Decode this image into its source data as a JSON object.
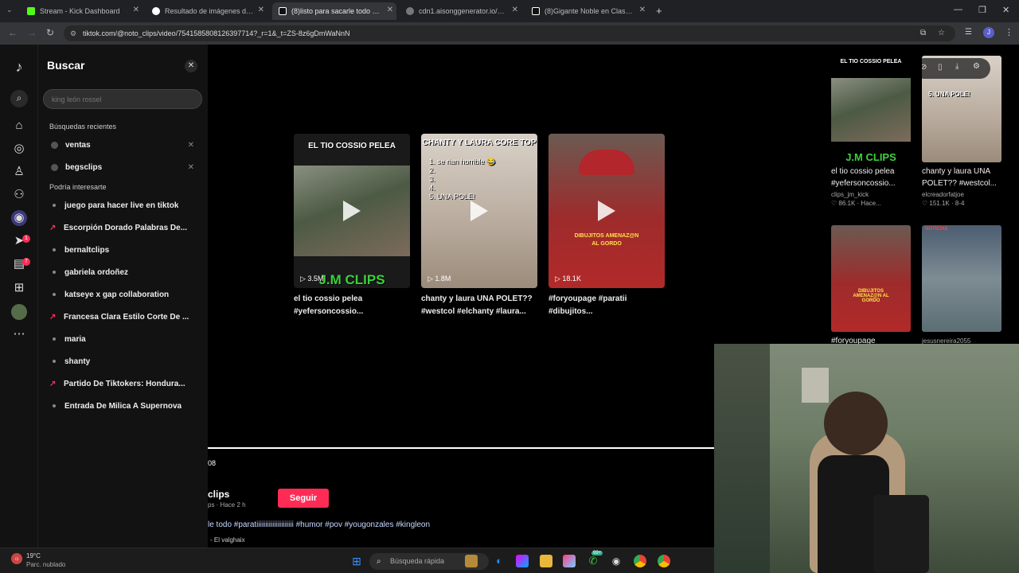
{
  "browser": {
    "tabs": [
      {
        "label": "Stream - Kick Dashboard"
      },
      {
        "label": "Resultado de imágenes de Goo"
      },
      {
        "label": "(8)listo para sacarle todo #parat"
      },
      {
        "label": "cdn1.aisonggenerator.io/7/aud"
      },
      {
        "label": "(8)Gigante Noble en Clash Roya"
      }
    ],
    "new_tab": "+",
    "url": "tiktok.com/@noto_clips/video/7541585808126397714?_r=1&_t=ZS-8z6gDmWaNnN",
    "avatar_letter": "J"
  },
  "search": {
    "title": "Buscar",
    "placeholder": "king león rossel",
    "recent_heading": "Búsquedas recientes",
    "recent": [
      {
        "label": "ventas"
      },
      {
        "label": "begsclips"
      }
    ],
    "suggest_heading": "Podría interesarte",
    "suggestions": [
      {
        "label": "juego para hacer live en tiktok",
        "trending": false
      },
      {
        "label": "Escorpión Dorado Palabras De...",
        "trending": true
      },
      {
        "label": "bernaltclips",
        "trending": false
      },
      {
        "label": "gabriela ordoñez",
        "trending": false
      },
      {
        "label": "katseye x gap collaboration",
        "trending": false
      },
      {
        "label": "Francesa Clara Estilo Corte De ...",
        "trending": true
      },
      {
        "label": "maria",
        "trending": false
      },
      {
        "label": "shanty",
        "trending": false
      },
      {
        "label": "Partido De Tiktokers: Hondura...",
        "trending": true
      },
      {
        "label": "Entrada De Milica A Supernova",
        "trending": false
      }
    ]
  },
  "rail_badges": {
    "inbox": "1",
    "messages": "7"
  },
  "grid": [
    {
      "overlay": "EL TIO COSSIO PELEA",
      "brand": "J.M CLIPS",
      "views": "3.5M",
      "title": "el tio cossio pelea #yefersoncossio..."
    },
    {
      "overlay": "CHANTY Y LAURA CORE TOP",
      "list": "1. se rian horrible 😂\n2.\n3.\n4.\n5. UNA POLE!",
      "views": "1.8M",
      "title": "chanty y laura UNA POLET?? #westcol #elchanty #laura..."
    },
    {
      "overlay": "DIBUJITOS AMENAZ@N AL GORDO",
      "views": "18.1K",
      "title": "#foryoupage #paratii #dibujitos..."
    }
  ],
  "right_grid": [
    {
      "overlay": "EL TIO COSSIO PELEA",
      "brand": "J.M CLIPS",
      "title": "el tio cossio pelea #yefersoncossio...",
      "author": "clips_jm_kick",
      "likes": "86.1K",
      "time": "Hace..."
    },
    {
      "overlay": "5. UNA POLE!",
      "title": "chanty y laura UNA POLET?? #westcol...",
      "author": "elcreadorfatjoe",
      "likes": "151.1K",
      "time": "8-4"
    },
    {
      "overlay": "DIBUJITOS AMENAZ@N AL GORDO",
      "title": "#foryoupage",
      "author": "",
      "likes": "",
      "time": ""
    },
    {
      "overlay": "NOTICIAS",
      "title": "jesusnereira2055",
      "author": "",
      "likes": "",
      "time": ""
    }
  ],
  "player": {
    "time": "08",
    "author": "clips",
    "meta": "ps · Hace 2 h",
    "follow": "Seguir",
    "caption": "le todo #paratiiiiiiiiiiiiiiiiiiiii #humor #pov #yougonzales #kingleon",
    "music": "- El valghaix"
  },
  "taskbar": {
    "weather_temp": "19°C",
    "weather_desc": "Parc. nublado",
    "search_placeholder": "Búsqueda rápida",
    "badge": "99+"
  },
  "colors": {
    "accent": "#fe2c55",
    "bg": "#000000",
    "panel": "#121212"
  }
}
